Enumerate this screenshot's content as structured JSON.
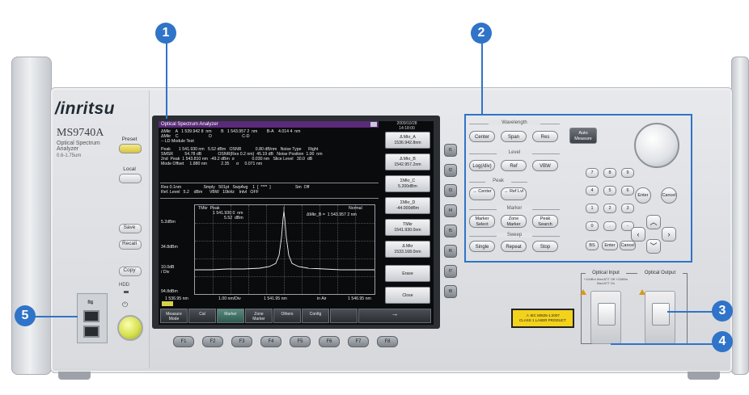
{
  "brand": {
    "logo": "/inritsu",
    "model": "MS9740A",
    "subtitle": "Optical Spectrum Analyzer",
    "range": "0.6-1.75um"
  },
  "left_keys": [
    {
      "id": "preset",
      "label": "Preset"
    },
    {
      "id": "local",
      "label": "Local"
    },
    {
      "id": "save",
      "label": "Save"
    },
    {
      "id": "recall",
      "label": "Recall"
    },
    {
      "id": "copy",
      "label": "Copy"
    }
  ],
  "hdd_label": "HDD",
  "screen": {
    "title": "Optical Spectrum Analyzer",
    "datetime": [
      "2009/10/28",
      "14:18:00"
    ],
    "measure_lines": [
      "ΔMkr    A   1 539.942 8  nm        B   1 543.957 2  nm        B-A    4.014 4  nm",
      "ΔMkr    C                          D                          C-D",
      "-- LD Module Test",
      "Peak       1 541.930 nm   5.52 dBm   OSNR            0.80 dB/nm   Noise Type      Right",
      "SMSR          54.78 dB              OSNR(Res 0.2 nm)  45.19 dB   Noise Position  1.00  nm",
      "2nd  Peak  1 543.810 nm  -49.2 dBm  σ               0.030 nm   Slice Level   30.0  dB",
      "Mode Offset     1.880 nm            2.35      σ     0.071 nm"
    ],
    "settings_lines": [
      "Res 0.1nm                   Smply   501pt   SwpAvg    1  [  ****  ]                     Sm  Off",
      "Ref. Level   5.2    dBm      VBW   10kHz    Intvl   OFF"
    ],
    "graph": {
      "y_labels": [
        "5.2dBm",
        "34.8dBm",
        "10.0dB\n/ Div",
        "94.8dBm"
      ],
      "top_labels": [
        "TMkr  Peak",
        "1 541.930 0  nm",
        "5.52  dBm"
      ],
      "marker_delta": "ΔMkr_B =  1 543.957 2 nm",
      "normal": "Normal",
      "x_labels": [
        "1 536.95 nm",
        "1.00 nm/Div",
        "1 541.95 nm",
        "in Air",
        "1 546.95 nm"
      ]
    },
    "softkeys": [
      {
        "line1": "Δ Mkr_A",
        "line2": "1536.942.8nm"
      },
      {
        "line1": "Δ Mkr_B",
        "line2": "1542.957.2nm"
      },
      {
        "line1": "ΣMkr_C",
        "line2": "5.200dBm"
      },
      {
        "line1": "ΣMkr_D",
        "line2": "-44.000dBm"
      },
      {
        "line1": "TMkr",
        "line2": "1541.930.0nm"
      },
      {
        "line1": "Δ Mkr",
        "line2": "1533.168.0nm"
      },
      {
        "line1": "Erase",
        "line2": ""
      },
      {
        "line1": "Close",
        "line2": ""
      }
    ],
    "bottom_tabs": [
      {
        "line1": "Measure",
        "line2": "Mode"
      },
      {
        "line1": "Cal",
        "line2": ""
      },
      {
        "line1": "Marker",
        "line2": ""
      },
      {
        "line1": "Zone",
        "line2": "Marker"
      },
      {
        "line1": "Others",
        "line2": ""
      },
      {
        "line1": "Config",
        "line2": ""
      },
      {
        "line1": "",
        "line2": ""
      },
      {
        "line1": "→",
        "line2": ""
      }
    ]
  },
  "side_keys": [
    "f1",
    "f2",
    "f3",
    "f4",
    "f5",
    "f6",
    "f7",
    "f8"
  ],
  "fkeys": [
    "F1",
    "F2",
    "F3",
    "F4",
    "F5",
    "F6",
    "F7",
    "F8"
  ],
  "panel": {
    "wavelength": {
      "label": "Wavelength",
      "keys": [
        "Center",
        "Span",
        "Res"
      ]
    },
    "level": {
      "label": "Level",
      "keys": [
        "Log(/div)",
        "Ref",
        "VBW"
      ]
    },
    "peak": {
      "label": "Peak",
      "keys": [
        "→ Center",
        "→ Ref Lvl"
      ]
    },
    "marker": {
      "label": "Marker",
      "keys": [
        "Marker Select",
        "Zone Marker",
        "Peak Search"
      ]
    },
    "sweep": {
      "label": "Sweep",
      "keys": [
        "Single",
        "Repeat",
        "Stop"
      ]
    },
    "auto_measure": "Auto Measure",
    "numpad": [
      "7",
      "8",
      "9",
      "4",
      "5",
      "6",
      "1",
      "2",
      "3",
      "0",
      ".",
      "-",
      "BS",
      "Enter",
      "Cancel"
    ],
    "enter": "Enter",
    "cancel": "Cancel"
  },
  "optical": {
    "input_label": "Optical Input",
    "input_sub": "+10dBm Max/ATT Off   +23dBm Max/ATT On",
    "output_label": "Optical Output",
    "laser_line1": "⚠  IEC 60825-1:2007",
    "laser_line2": "CLASS 1 LASER PRODUCT"
  },
  "callouts": [
    "1",
    "2",
    "3",
    "4",
    "5"
  ],
  "colors": {
    "callout": "#2f74c8",
    "screen_title": "#5b2a7a",
    "power_switch": "#d6e04e",
    "laser_label": "#f3d21c"
  }
}
